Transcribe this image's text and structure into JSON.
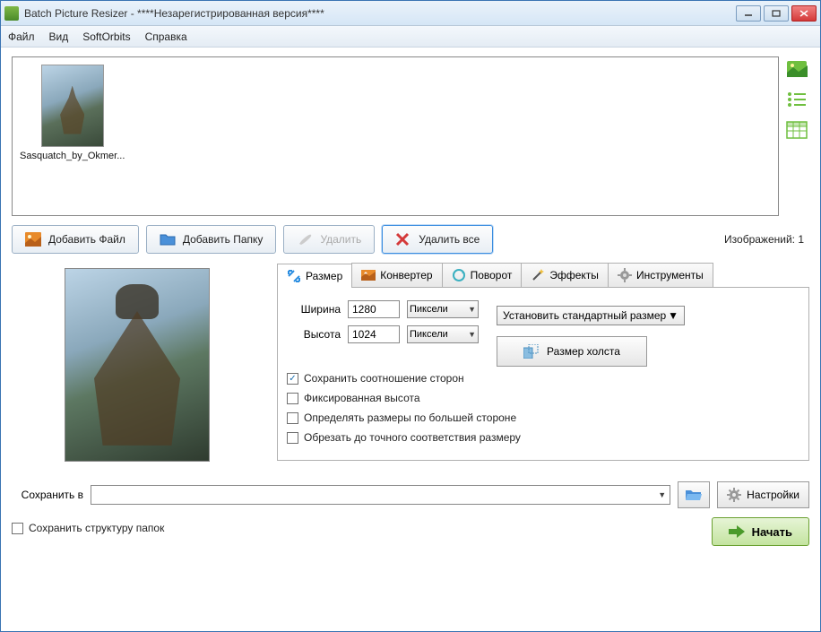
{
  "window": {
    "title": "Batch Picture Resizer - ****Незарегистрированная версия****"
  },
  "menu": {
    "file": "Файл",
    "view": "Вид",
    "softorbits": "SoftOrbits",
    "help": "Справка"
  },
  "thumbnails": [
    {
      "name": "Sasquatch_by_Okmer..."
    }
  ],
  "toolbar": {
    "add_file": "Добавить Файл",
    "add_folder": "Добавить Папку",
    "delete": "Удалить",
    "delete_all": "Удалить все",
    "count_label": "Изображений: 1"
  },
  "tabs": {
    "size": "Размер",
    "converter": "Конвертер",
    "rotate": "Поворот",
    "effects": "Эффекты",
    "tools": "Инструменты"
  },
  "size_panel": {
    "width_label": "Ширина",
    "height_label": "Высота",
    "width_value": "1280",
    "height_value": "1024",
    "unit_pixels": "Пиксели",
    "preset_label": "Установить стандартный размер",
    "canvas_label": "Размер холста",
    "keep_ratio": "Сохранить соотношение сторон",
    "fixed_height": "Фиксированная высота",
    "by_larger_side": "Определять размеры по большей стороне",
    "crop_exact": "Обрезать до точного соответствия размеру",
    "keep_ratio_checked": true
  },
  "save": {
    "label": "Сохранить в",
    "value": "",
    "settings_label": "Настройки",
    "keep_folder_structure": "Сохранить структуру папок",
    "start_label": "Начать"
  }
}
